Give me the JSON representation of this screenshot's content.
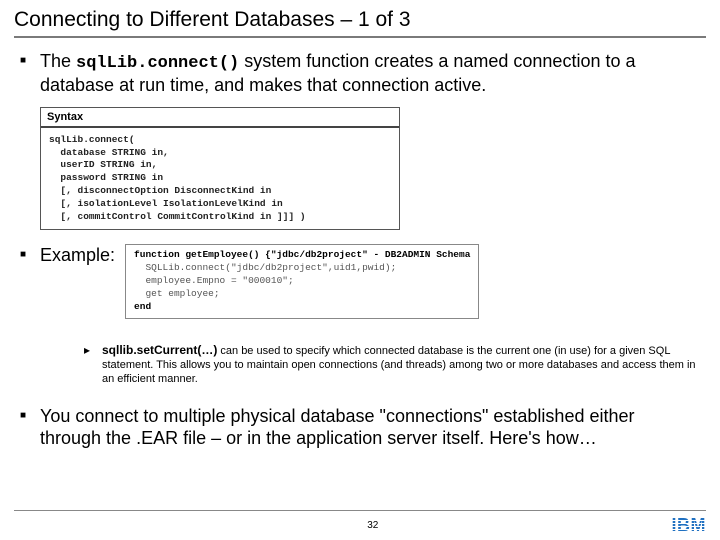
{
  "title": "Connecting to Different Databases – 1 of 3",
  "bullet1_pre": "The ",
  "bullet1_code": "sqlLib.connect()",
  "bullet1_post": " system function creates a named connection to a database at run time, and makes that connection active.",
  "syntax": {
    "heading": "Syntax",
    "body": "sqlLib.connect(\n  database STRING in,\n  userID STRING in,\n  password STRING in\n  [, disconnectOption DisconnectKind in\n  [, isolationLevel IsolationLevelKind in\n  [, commitControl CommitControlKind in ]]] )"
  },
  "example_label": "Example:",
  "example_code": {
    "l1": "function getEmployee() {\"jdbc/db2project\" - DB2ADMIN Schema",
    "l2": "  SQLLib.connect(\"jdbc/db2project\",uid1,pwid);",
    "l3": "  employee.Empno = \"000010\";",
    "l4": "  get employee;",
    "l5": "end"
  },
  "subnote_lead": "sqllib.setCurrent(…)",
  "subnote_rest": " can be used to specify which connected database is the current one (in use) for a given SQL statement. This allows you to maintain open connections (and threads) among two or more databases and access them in an efficient manner.",
  "final": "You connect to multiple physical database \"connections\" established either through the .EAR file – or in the application server itself.  Here's how…",
  "page": "32",
  "logo": "IBM"
}
